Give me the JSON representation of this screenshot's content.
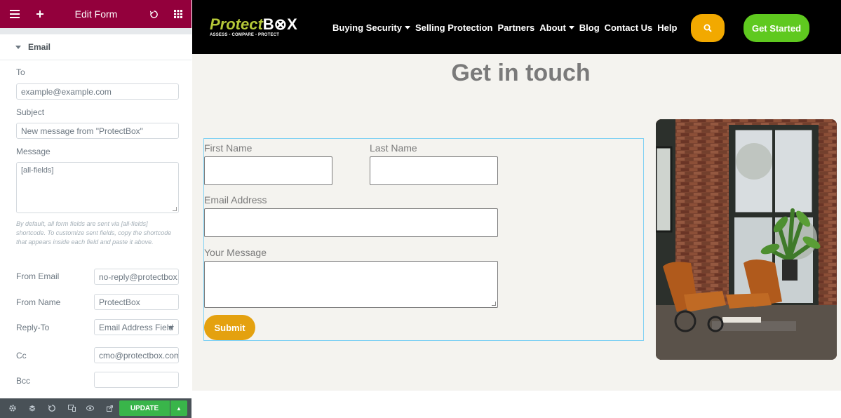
{
  "editor": {
    "title": "Edit Form",
    "section_title": "Email",
    "to_label": "To",
    "to_placeholder": "example@example.com",
    "subject_label": "Subject",
    "subject_value": "New message from \"ProtectBox\"",
    "message_label": "Message",
    "message_value": "[all-fields]",
    "help_text": "By default, all form fields are sent via [all-fields] shortcode. To customize sent fields, copy the shortcode that appears inside each field and paste it above.",
    "from_email_label": "From Email",
    "from_email_value": "no-reply@protectbox.co",
    "from_name_label": "From Name",
    "from_name_value": "ProtectBox",
    "reply_to_label": "Reply-To",
    "reply_to_value": "Email Address Field",
    "cc_label": "Cc",
    "cc_value": "cmo@protectbox.com,t",
    "bcc_label": "Bcc",
    "bcc_value": "",
    "update_label": "UPDATE"
  },
  "site": {
    "logo_part1": "Protect",
    "logo_part2": "B⊗X",
    "logo_tagline": "ASSESS - COMPARE - PROTECT",
    "nav": [
      {
        "label": "Buying Security",
        "dropdown": true
      },
      {
        "label": "Selling Protection",
        "dropdown": false
      },
      {
        "label": "Partners",
        "dropdown": false
      },
      {
        "label": "About",
        "dropdown": true
      },
      {
        "label": "Blog",
        "dropdown": false
      },
      {
        "label": "Contact Us",
        "dropdown": false
      },
      {
        "label": "Help",
        "dropdown": false
      }
    ],
    "get_started_label": "Get Started",
    "heading": "Get in touch",
    "form": {
      "first_name_label": "First Name",
      "last_name_label": "Last Name",
      "email_label": "Email Address",
      "message_label": "Your Message",
      "submit_label": "Submit"
    }
  },
  "colors": {
    "editor_header": "#93003c",
    "update_button": "#39b54a",
    "logo_accent": "#b5c838",
    "search_button": "#f2a900",
    "get_started_button": "#5fc91f",
    "submit_button": "#e4a10f",
    "content_background": "#f4f3ef"
  },
  "icons": {
    "editor_header": [
      "hamburger-icon",
      "plus-icon",
      "history-icon",
      "grid-icon"
    ],
    "editor_footer": [
      "settings-icon",
      "layers-icon",
      "history-icon",
      "responsive-icon",
      "preview-icon",
      "external-link-icon"
    ],
    "search": "search-icon",
    "collapse": "chevron-left-icon"
  }
}
